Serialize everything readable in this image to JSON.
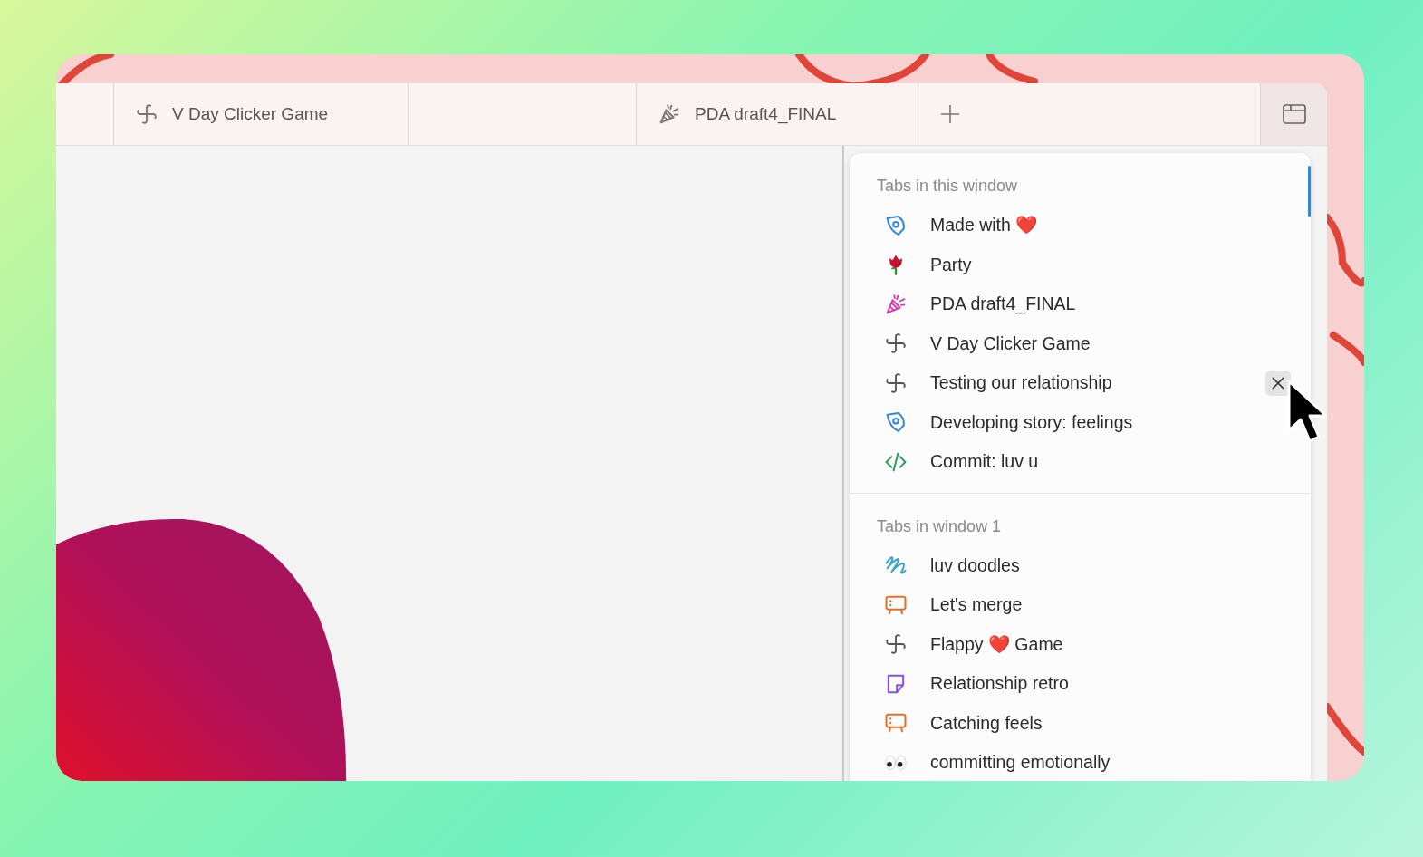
{
  "tabs": [
    {
      "title": "V Day Clicker Game",
      "kind": "game"
    },
    {
      "title": "PDA draft4_FINAL",
      "kind": "confetti"
    }
  ],
  "tab_menu": {
    "sections": [
      {
        "heading": "Tabs in this window",
        "items": [
          {
            "title": "Made with ❤️",
            "kind": "pen",
            "hovered": false
          },
          {
            "title": "Party",
            "kind": "rose",
            "hovered": false
          },
          {
            "title": "PDA draft4_FINAL",
            "kind": "confetti",
            "hovered": false
          },
          {
            "title": "V Day Clicker Game",
            "kind": "game",
            "hovered": false
          },
          {
            "title": "Testing our relationship",
            "kind": "game",
            "hovered": true
          },
          {
            "title": "Developing story: feelings",
            "kind": "pen",
            "hovered": false
          },
          {
            "title": "Commit: luv u",
            "kind": "code",
            "hovered": false
          }
        ]
      },
      {
        "heading": "Tabs in window 1",
        "items": [
          {
            "title": "luv doodles",
            "kind": "doodle",
            "hovered": false
          },
          {
            "title": "Let's merge",
            "kind": "board",
            "hovered": false
          },
          {
            "title": "Flappy ❤️ Game",
            "kind": "game",
            "hovered": false
          },
          {
            "title": "Relationship retro",
            "kind": "sticky",
            "hovered": false
          },
          {
            "title": "Catching feels",
            "kind": "board",
            "hovered": false
          },
          {
            "title": "committing emotionally",
            "kind": "eyes",
            "hovered": false
          }
        ]
      }
    ]
  }
}
